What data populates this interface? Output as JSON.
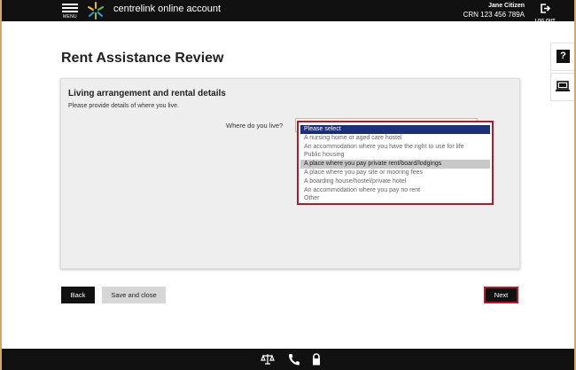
{
  "header": {
    "menu_label": "MENU",
    "brand": "centrelink online account",
    "user_name": "Jane Citizen",
    "user_crn": "CRN 123 456 789A",
    "logout_label": "LOG OUT"
  },
  "side_tools": {
    "help_glyph": "?",
    "screen_icon": "laptop-icon"
  },
  "page": {
    "title": "Rent Assistance Review",
    "section_heading": "Living arrangement and rental details",
    "section_desc": "Please provide details of where you live.",
    "field_label": "Where do you live?",
    "options": [
      "Please select",
      "A nursing home or aged care hostel",
      "An accommodation where you have the right to use for life",
      "Public housing",
      "A place where you pay private rent/board/lodgings",
      "A place where you pay site or mooring fees",
      "A boarding house/hostel/private hotel",
      "An accommodation where you pay no rent",
      "Other"
    ],
    "selected_option": "Please select",
    "highlighted_option": "A place where you pay private rent/board/lodgings"
  },
  "buttons": {
    "back": "Back",
    "save_close": "Save and close",
    "next": "Next"
  },
  "footer_icons": [
    "scales-icon",
    "phone-icon",
    "lock-icon"
  ],
  "colors": {
    "header_bg": "#111111",
    "accent_red": "#b01c2e",
    "selected_blue": "#1c2f7a",
    "panel_bg": "#eeeeee"
  }
}
